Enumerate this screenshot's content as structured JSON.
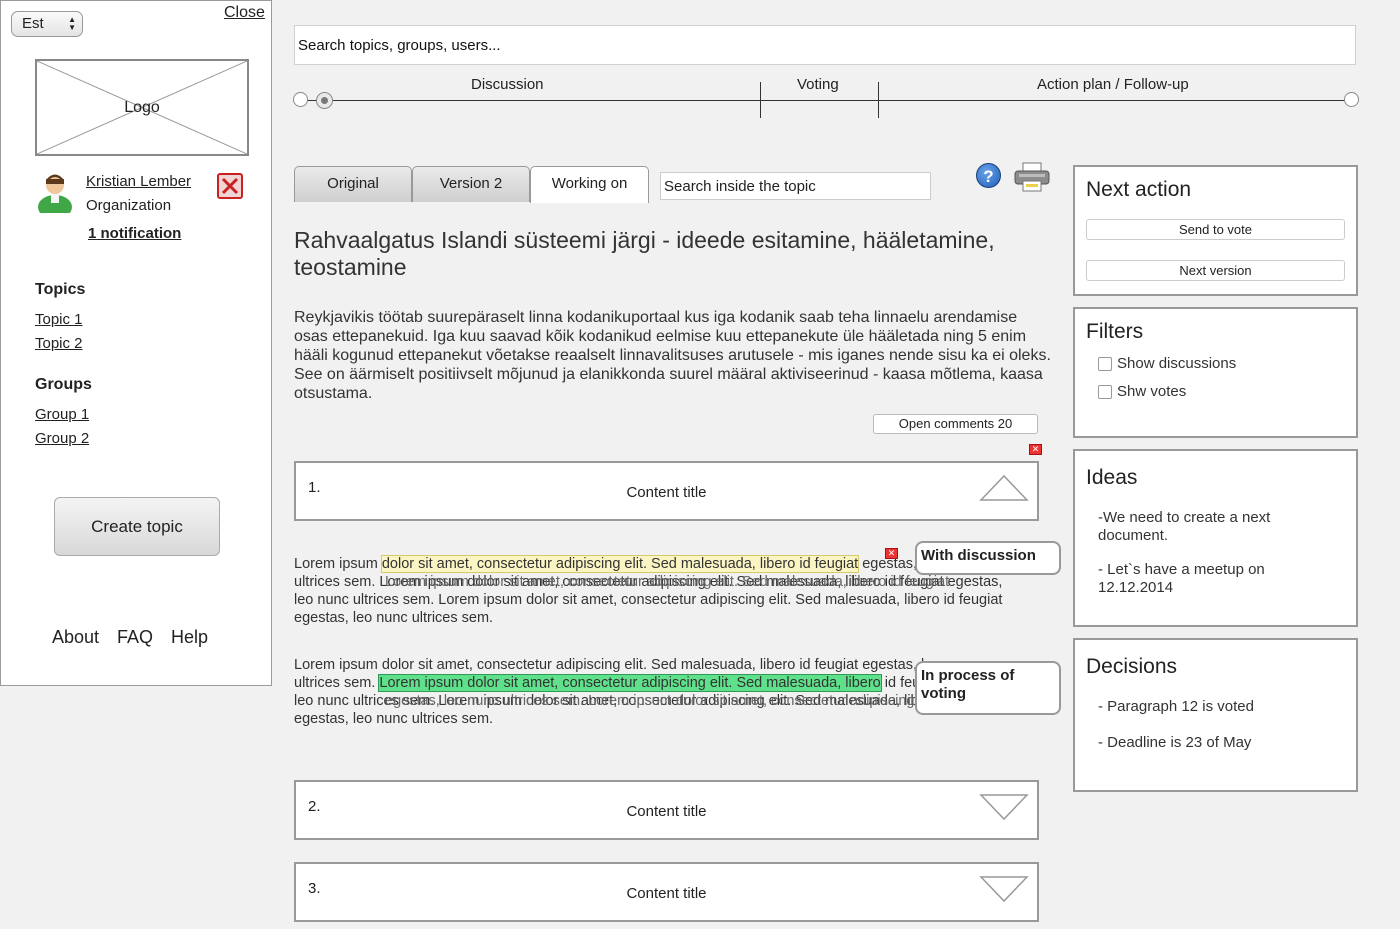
{
  "sidebar": {
    "language": "Est",
    "close_label": "Close",
    "logo_label": "Logo",
    "user_name": "Kristian Lember",
    "organization": "Organization",
    "notification": "1 notification",
    "topics_title": "Topics",
    "topics": [
      "Topic 1",
      "Topic 2"
    ],
    "groups_title": "Groups",
    "groups": [
      "Group 1",
      "Group 2"
    ],
    "create_topic": "Create topic",
    "footer": [
      "About",
      "FAQ",
      "Help"
    ]
  },
  "search": {
    "placeholder": "Search topics, groups, users..."
  },
  "timeline": {
    "stages": [
      "Discussion",
      "Voting",
      "Action plan / Follow-up"
    ]
  },
  "tabs": [
    "Original",
    "Version 2",
    "Working on"
  ],
  "active_tab": "Working on",
  "topic_search": "Search inside the topic",
  "topic": {
    "title": "Rahvaalgatus Islandi süsteemi järgi - ideede esitamine, hääletamine, teostamine",
    "description": "Reykjavikis töötab suurepäraselt linna kodanikuportaal kus iga kodanik saab teha linnaelu arendamise osas ettepanekuid. Iga kuu saavad kõik kodanikud eelmise kuu ettepanekute üle hääletada ning 5 enim hääli kogunud ettepanekut võetakse reaalselt linnavalitsuses arutusele - mis iganes nende sisu ka ei oleks. See on äärmiselt positiivselt mõjunud ja elanikkonda suurel määral aktiviseerinud - kaasa mõtlema, kaasa otsustama.",
    "open_comments": "Open comments 20"
  },
  "content_items": [
    {
      "num": "1.",
      "title": "Content title"
    },
    {
      "num": "2.",
      "title": "Content title"
    },
    {
      "num": "3.",
      "title": "Content title"
    }
  ],
  "lorem1": {
    "before": "Lorem ipsum ",
    "highlight": "dolor sit amet, consectetur adipiscing elit. Sed malesuada, libero id feugiat",
    "after": " egestas, leo nunc ultrices sem. Lorem ipsum dolor sit amet, consectetur adipiscing elit. Sed malesuada, libero id feugiat egestas, leo nunc ultrices sem. Lorem ipsum dolor sit amet, consectetur adipiscing elit. Sed malesuada, libero id feugiat egestas, leo nunc ultrices sem.",
    "overlay": "Lorem ipsum dolor sit amet, consectetur adipiscing elit. Sed malesuada, libero id feugiat",
    "callout": "With discussion"
  },
  "lorem2": {
    "before": "Lorem ipsum dolor sit amet, consectetur adipiscing elit. Sed malesuada, libero id feugiat egestas, leo nunc ultrices sem. ",
    "highlight": "Lorem ipsum dolor sit amet, consectetur adipiscing elit. Sed malesuada, libero",
    "after": " id feugiat egestas, leo nunc ultrices sem. Lorem ipsum dolor sit amet, consectetur adipiscing elit. Sed malesuada, libero id feugiat egestas, leo nunc ultrices sem.",
    "overlay": "egestas, leo nunc ultrices sem. Lorem ipsum dolor sit amet, consectetur adipiscing elit. Sed",
    "callout": "In process of voting"
  },
  "next_action": {
    "title": "Next action",
    "buttons": [
      "Send to vote",
      "Next version"
    ]
  },
  "filters": {
    "title": "Filters",
    "options": [
      "Show discussions",
      "Shw votes"
    ]
  },
  "ideas": {
    "title": "Ideas",
    "items": [
      "-We need to create a next document.",
      "- Let`s have a meetup on 12.12.2014"
    ]
  },
  "decisions": {
    "title": "Decisions",
    "items": [
      "- Paragraph 12 is voted",
      "- Deadline is 23 of May"
    ]
  },
  "colors": {
    "highlight_discussion": "#fbf5c4",
    "highlight_voting": "#5fe08a",
    "close_red": "#c92020"
  }
}
